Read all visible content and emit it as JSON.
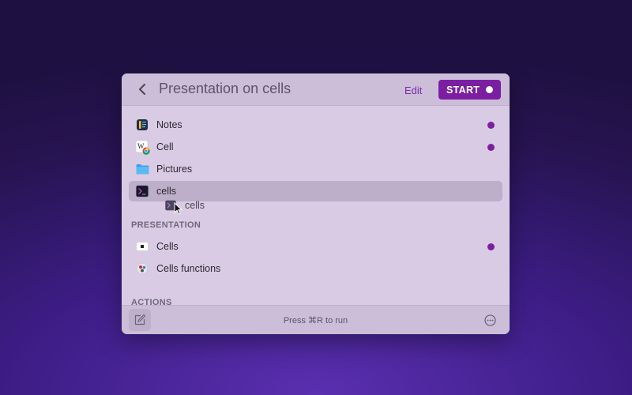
{
  "header": {
    "title": "Presentation on cells",
    "edit_label": "Edit",
    "start_label": "START"
  },
  "items": [
    {
      "label": "Notes",
      "icon": "notes-icon",
      "marked": true
    },
    {
      "label": "Cell",
      "icon": "wikipedia-chrome-icon",
      "marked": true
    },
    {
      "label": "Pictures",
      "icon": "folder-icon",
      "marked": false
    },
    {
      "label": "cells",
      "icon": "terminal-icon",
      "marked": false,
      "selected": true
    }
  ],
  "drag_ghost": {
    "label": "cells",
    "icon": "terminal-icon"
  },
  "sections": {
    "presentation": {
      "title": "PRESENTATION",
      "items": [
        {
          "label": "Cells",
          "icon": "slide-icon",
          "marked": true
        },
        {
          "label": "Cells functions",
          "icon": "function-icon",
          "marked": false
        }
      ]
    },
    "actions": {
      "title": "ACTIONS"
    }
  },
  "footer": {
    "hint": "Press ⌘R to run"
  },
  "colors": {
    "accent": "#7b1fa2",
    "panel": "#d9cbe4",
    "header": "#ccbdd9"
  }
}
